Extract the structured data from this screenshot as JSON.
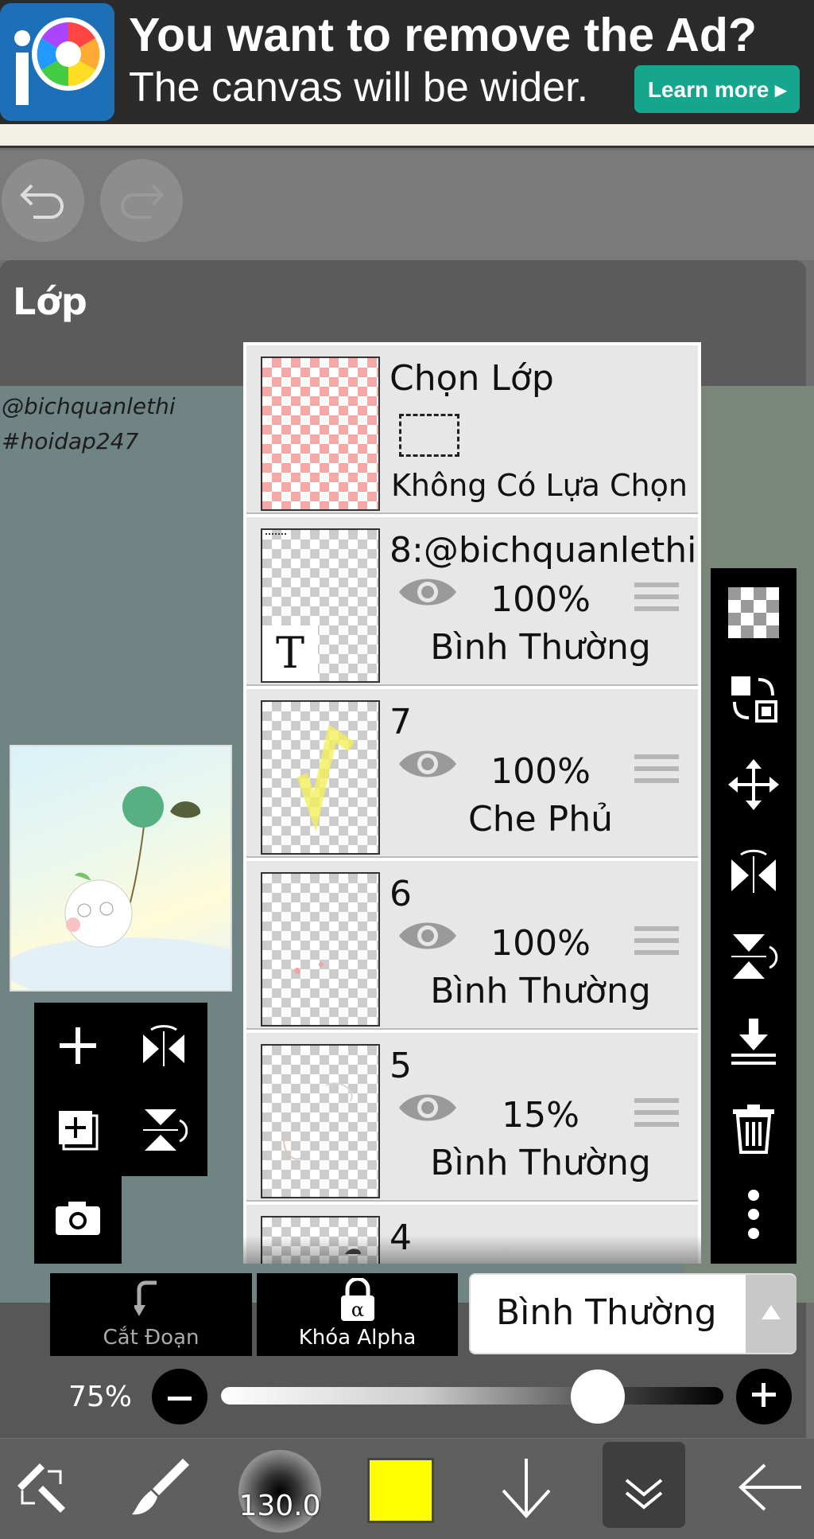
{
  "ad": {
    "title": "You want to remove the Ad?",
    "subtitle": "The canvas will be wider.",
    "button": "Learn more ▸",
    "logo_icon": "ibis-paint-icon"
  },
  "panel": {
    "title": "Lớp"
  },
  "watermark": {
    "line1": "@bichquanlethi",
    "line2": "#hoidap247"
  },
  "selection_layer": {
    "title": "Chọn Lớp",
    "status": "Không Có Lựa Chọn"
  },
  "layers": [
    {
      "name": "8:@bichquanlethi",
      "opacity": "100%",
      "blend": "Bình Thường",
      "thumb_label": "T"
    },
    {
      "name": "7",
      "opacity": "100%",
      "blend": "Che Phủ"
    },
    {
      "name": "6",
      "opacity": "100%",
      "blend": "Bình Thường"
    },
    {
      "name": "5",
      "opacity": "15%",
      "blend": "Bình Thường"
    },
    {
      "name": "4"
    }
  ],
  "controls": {
    "clipping_label": "Cắt Đoạn",
    "alpha_lock_label": "Khóa Alpha",
    "blend_mode": "Bình Thường",
    "opacity_value": "75%",
    "opacity_fraction": 0.75
  },
  "bottom": {
    "brush_size": "130.0",
    "color": "#ffff00"
  },
  "icons": {
    "undo": "undo-icon",
    "redo": "redo-icon",
    "add_layer": "plus-icon",
    "flip_h": "flip-horizontal-icon",
    "add_copy": "add-layer-copy-icon",
    "flip_v": "flip-vertical-icon",
    "camera": "camera-icon",
    "checker": "transparent-fill-icon",
    "swap": "swap-layers-icon",
    "move": "move-icon",
    "merge_down": "merge-down-icon",
    "delete": "trash-icon",
    "more": "more-vertical-icon"
  }
}
